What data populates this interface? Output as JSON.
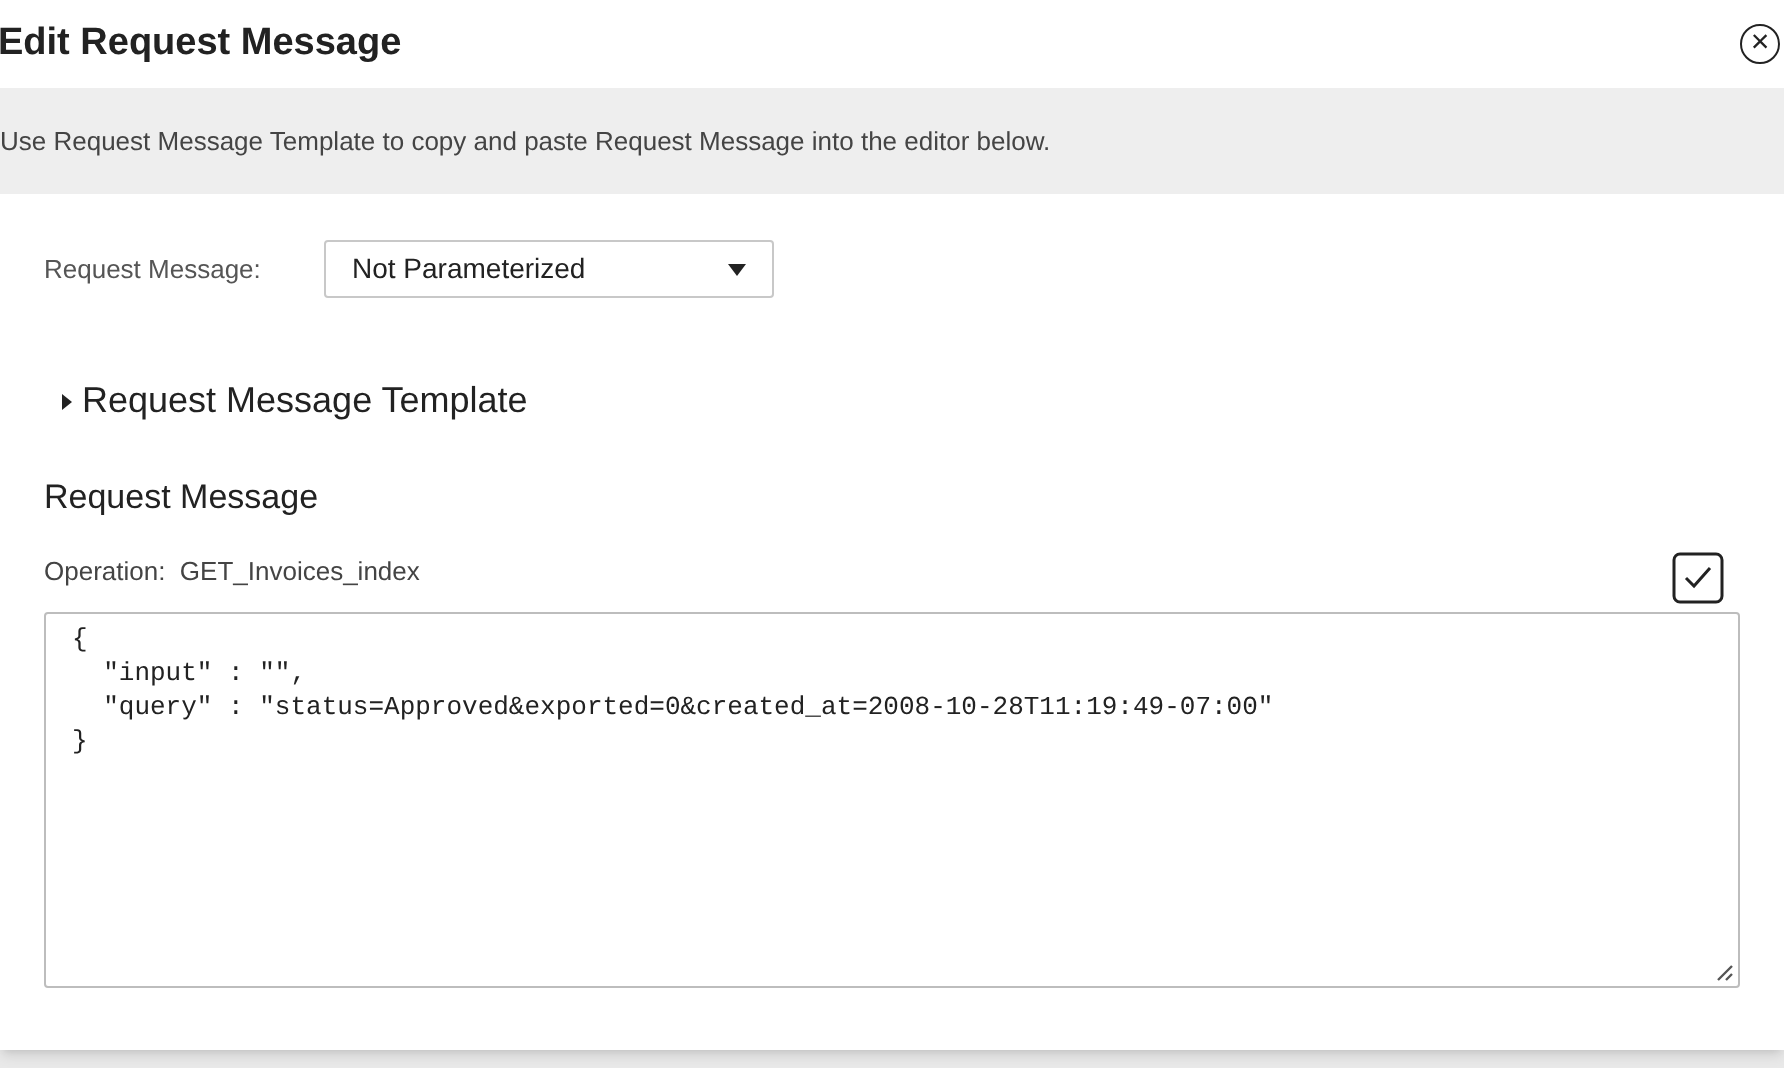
{
  "dialog": {
    "title": "Edit Request Message",
    "close_button": "×"
  },
  "info_banner": "Use Request Message Template to copy and paste Request Message into the editor below.",
  "request_message_field": {
    "label": "Request Message:",
    "value": "Not Parameterized"
  },
  "template_section": {
    "title": "Request Message Template",
    "expanded": false
  },
  "section_heading": "Request Message",
  "operation": {
    "label": "Operation:",
    "value": "GET_Invoices_index"
  },
  "editor": {
    "lines": [
      "{",
      "  \"input\" : \"\",",
      "  \"query\" : \"status=Approved&exported=0&created_at=2008-10-28T11:19:49-07:00\"",
      "}"
    ]
  }
}
